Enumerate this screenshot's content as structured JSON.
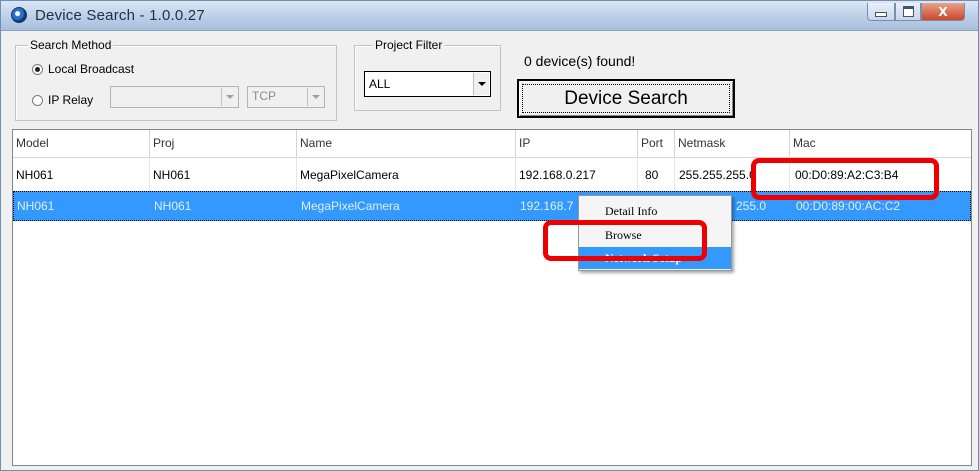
{
  "window": {
    "title": "Device Search - 1.0.0.27",
    "controls": {
      "minimize": "min-icon",
      "maximize": "max-icon",
      "close": "X"
    }
  },
  "search_method": {
    "legend": "Search Method",
    "local_broadcast_label": "Local Broadcast",
    "ip_relay_label": "IP Relay",
    "ip_relay_value": "",
    "protocol_value": "TCP",
    "selected": "Local Broadcast"
  },
  "project_filter": {
    "legend": "Project Filter",
    "value": "ALL"
  },
  "status": {
    "found_text": "0 device(s) found!"
  },
  "search_button": {
    "label": "Device Search"
  },
  "table": {
    "columns": [
      "Model",
      "Proj",
      "Name",
      "IP",
      "Port",
      "Netmask",
      "Mac"
    ],
    "rows": [
      [
        "NH061",
        "NH061",
        "MegaPixelCamera",
        "192.168.0.217",
        "80",
        "255.255.255.0",
        "00:D0:89:A2:C3:B4"
      ],
      [
        "NH061",
        "NH061",
        "MegaPixelCamera",
        "192.168.7",
        "",
        "255.0",
        "00:D0:89:00:AC:C2"
      ]
    ],
    "selected_row": 1
  },
  "context_menu": {
    "items": [
      "Detail Info",
      "Browse",
      "Network Setup"
    ],
    "highlighted": "Network Setup"
  },
  "colors": {
    "selection": "#3399ff",
    "annotation": "#ee0000",
    "titlebar": "#b9cde5"
  }
}
